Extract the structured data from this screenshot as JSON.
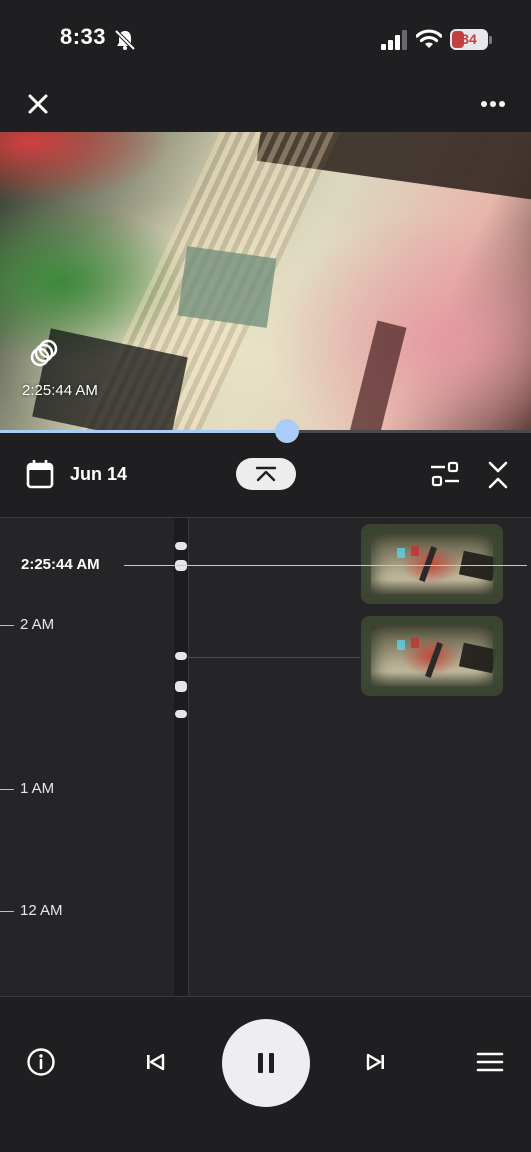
{
  "status_bar": {
    "time": "8:33",
    "battery": "34",
    "silent_icon": "bell-slash-icon",
    "signal_icon": "signal-icon",
    "wifi_icon": "wifi-icon",
    "battery_color": "#c44040"
  },
  "top_bar": {
    "close_icon": "close-icon",
    "more_icon": "more-horizontal-icon"
  },
  "video": {
    "timestamp": "2:25:44 AM",
    "badge_icon": "rings-icon",
    "progress": 0.54
  },
  "date_bar": {
    "date": "Jun 14",
    "calendar_icon": "calendar-icon",
    "collapse_icon": "chevron-up-icon",
    "filter_icon": "filter-icon",
    "expand_icon": "expand-collapse-icon"
  },
  "timeline": {
    "current_time": "2:25:44 AM",
    "hours": [
      "2 AM",
      "1 AM",
      "12 AM"
    ],
    "event_count": 5,
    "thumbnails": 2,
    "accent": "#a9cdf7"
  },
  "controls": {
    "info_icon": "info-icon",
    "prev_icon": "skip-previous-icon",
    "play_state": "pause-icon",
    "next_icon": "skip-next-icon",
    "menu_icon": "menu-icon"
  }
}
